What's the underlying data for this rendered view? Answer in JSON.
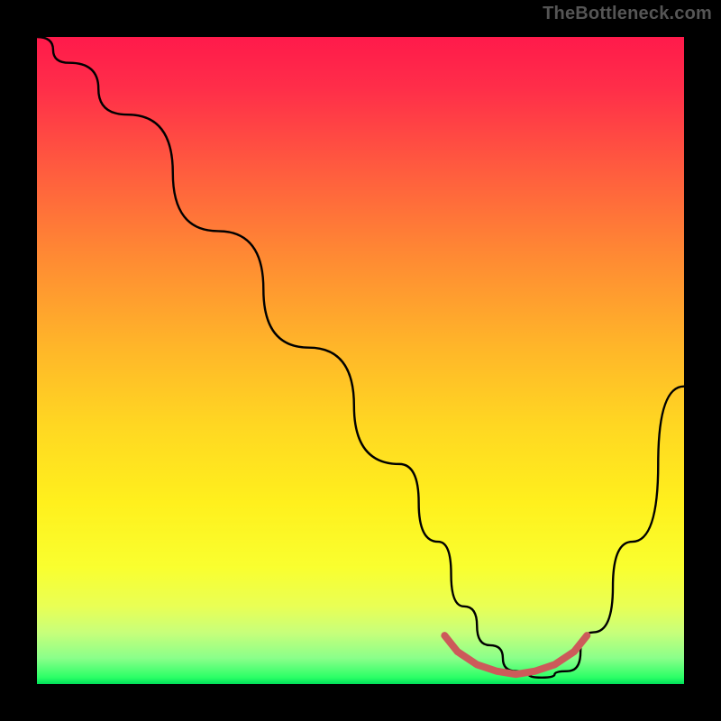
{
  "attribution": "TheBottleneck.com",
  "chart_data": {
    "type": "line",
    "title": "",
    "xlabel": "",
    "ylabel": "",
    "xlim": [
      0,
      100
    ],
    "ylim": [
      0,
      100
    ],
    "grid": false,
    "legend": false,
    "series": [
      {
        "name": "bottleneck-curve",
        "x": [
          0,
          5,
          14,
          28,
          42,
          56,
          62,
          66,
          70,
          74,
          78,
          82,
          86,
          92,
          100
        ],
        "y": [
          100,
          96,
          88,
          70,
          52,
          34,
          22,
          12,
          6,
          2,
          1,
          2,
          8,
          22,
          46
        ],
        "color": "#000000"
      },
      {
        "name": "sweet-spot-marker",
        "x": [
          63,
          65,
          68,
          71,
          74,
          77,
          80,
          83,
          85
        ],
        "y": [
          7.5,
          5,
          3,
          2,
          1.5,
          2,
          3,
          5,
          7.5
        ],
        "color": "#cc5a5a"
      }
    ],
    "background_gradient": {
      "direction": "vertical",
      "stops": [
        {
          "pos": 0.0,
          "color": "#ff1a4b"
        },
        {
          "pos": 0.2,
          "color": "#ff5a3f"
        },
        {
          "pos": 0.48,
          "color": "#ffb629"
        },
        {
          "pos": 0.72,
          "color": "#fff01d"
        },
        {
          "pos": 0.92,
          "color": "#c8ff7a"
        },
        {
          "pos": 1.0,
          "color": "#00e05a"
        }
      ]
    }
  },
  "frame": {
    "border_color": "#000000",
    "border_width_px": 41,
    "inner_size_px": 718
  }
}
